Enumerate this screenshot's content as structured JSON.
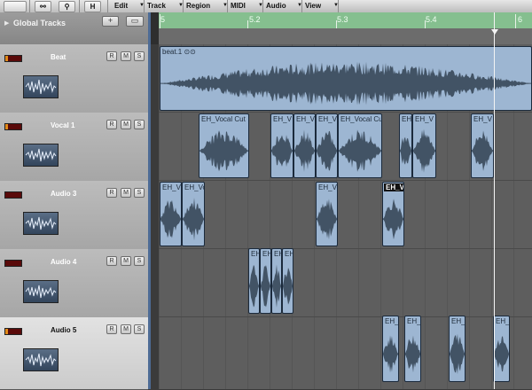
{
  "toolbar": {
    "items": [
      {
        "name": "link-icon",
        "label": ""
      },
      {
        "name": "running-man-icon",
        "label": ""
      },
      {
        "name": "hide-button",
        "label": "H"
      }
    ],
    "menus": [
      "Edit",
      "Track",
      "Region",
      "MIDI",
      "Audio",
      "View"
    ]
  },
  "global_tracks": {
    "label": "Global Tracks",
    "add_label": "+",
    "add_folder_label": "+"
  },
  "ruler": {
    "bars": [
      "5",
      "5.2",
      "5.3",
      "5.4",
      "6"
    ]
  },
  "tracks": [
    {
      "name": "Beat",
      "record": "R",
      "mute": "M",
      "solo": "S",
      "selected": false
    },
    {
      "name": "Vocal 1",
      "record": "R",
      "mute": "M",
      "solo": "S",
      "selected": false
    },
    {
      "name": "Audio 3",
      "record": "R",
      "mute": "M",
      "solo": "S",
      "selected": false
    },
    {
      "name": "Audio 4",
      "record": "R",
      "mute": "M",
      "solo": "S",
      "selected": false
    },
    {
      "name": "Audio 5",
      "record": "R",
      "mute": "M",
      "solo": "S",
      "selected": true
    }
  ],
  "regions": {
    "beat": [
      {
        "title": "beat.1 ⊙⊙",
        "selected": false
      }
    ],
    "vocal1": [
      {
        "title": "EH_Vocal Cut",
        "selected": false
      },
      {
        "title": "EH_V",
        "selected": false
      },
      {
        "title": "EH_V",
        "selected": false
      },
      {
        "title": "EH_V",
        "selected": false
      },
      {
        "title": "EH_Vocal Cu",
        "selected": false
      },
      {
        "title": "EH",
        "selected": false
      },
      {
        "title": "EH_V",
        "selected": false
      },
      {
        "title": "EH_V",
        "selected": false
      }
    ],
    "audio3": [
      {
        "title": "EH_V",
        "selected": false
      },
      {
        "title": "EH_Vo",
        "selected": false
      },
      {
        "title": "EH_V",
        "selected": false
      },
      {
        "title": "EH_V",
        "selected": true
      }
    ],
    "audio4": [
      {
        "title": "EH",
        "selected": false
      },
      {
        "title": "EH",
        "selected": false
      },
      {
        "title": "EH",
        "selected": false
      },
      {
        "title": "EH",
        "selected": false
      }
    ],
    "audio5": [
      {
        "title": "EH_",
        "selected": false
      },
      {
        "title": "EH_",
        "selected": false
      },
      {
        "title": "EH_",
        "selected": false
      },
      {
        "title": "EH_",
        "selected": false
      }
    ]
  }
}
